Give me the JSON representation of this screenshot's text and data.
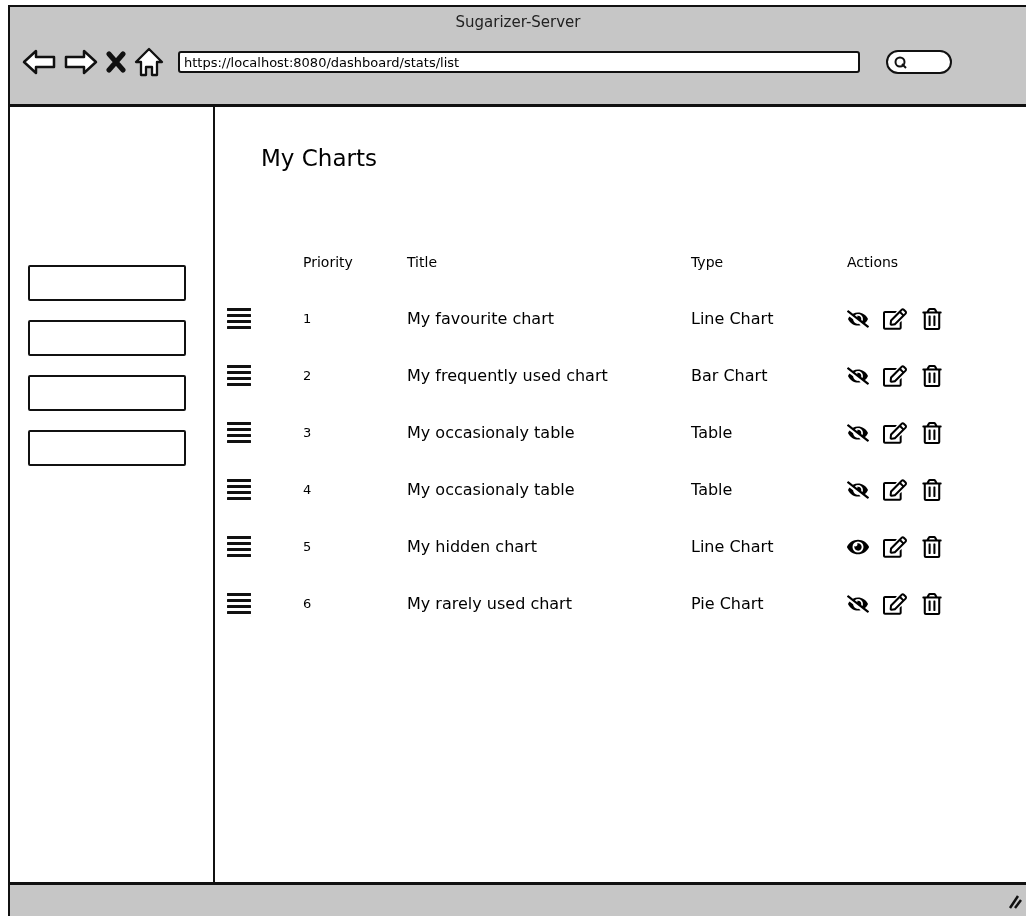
{
  "window": {
    "title": "Sugarizer-Server"
  },
  "address_bar": {
    "value": "https://localhost:8080/dashboard/stats/list"
  },
  "page": {
    "title": "My Charts"
  },
  "table": {
    "columns": [
      "Priority",
      "Title",
      "Type",
      "Actions"
    ],
    "rows": [
      {
        "priority": "1",
        "title": "My favourite chart",
        "type": "Line Chart",
        "hidden": false
      },
      {
        "priority": "2",
        "title": "My frequently used chart",
        "type": "Bar Chart",
        "hidden": false
      },
      {
        "priority": "3",
        "title": "My occasionaly table",
        "type": "Table",
        "hidden": false
      },
      {
        "priority": "4",
        "title": "My occasionaly table",
        "type": "Table",
        "hidden": false
      },
      {
        "priority": "5",
        "title": "My hidden chart",
        "type": "Line Chart",
        "hidden": true
      },
      {
        "priority": "6",
        "title": "My rarely used chart",
        "type": "Pie Chart",
        "hidden": false
      }
    ]
  }
}
